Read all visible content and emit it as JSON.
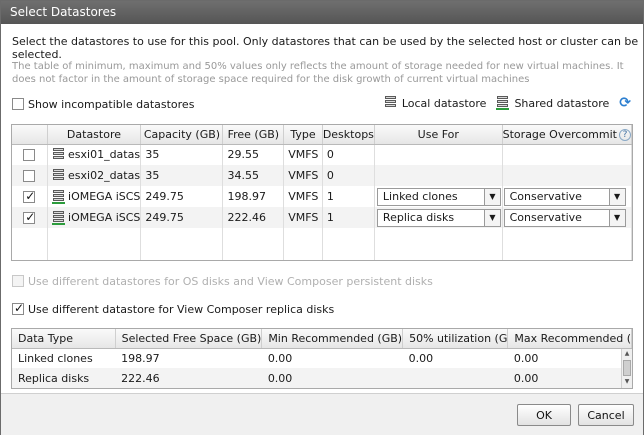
{
  "window": {
    "title": "Select Datastores"
  },
  "intro": "Select the datastores to use for this pool. Only datastores that can be used by the selected host or cluster can be selected.",
  "note": "The table of minimum, maximum and 50% values only reflects the amount of storage needed for new virtual machines. It does not factor in the amount of storage space required for the disk growth of current virtual machines",
  "show_incompatible": {
    "label": "Show incompatible datastores",
    "checked": false
  },
  "legend": {
    "local": "Local datastore",
    "shared": "Shared datastore"
  },
  "datastore_table": {
    "headers": [
      "",
      "Datastore",
      "Capacity (GB)",
      "Free (GB)",
      "Type",
      "Desktops",
      "Use For",
      "Storage Overcommit"
    ],
    "help_icon": "?",
    "rows": [
      {
        "checked": false,
        "icon": "local",
        "name": "esxi01_datas",
        "capacity": "35",
        "free": "29.55",
        "type": "VMFS",
        "desktops": "0",
        "use_for": "",
        "overcommit": ""
      },
      {
        "checked": false,
        "icon": "local",
        "name": "esxi02_datas",
        "capacity": "35",
        "free": "34.55",
        "type": "VMFS",
        "desktops": "0",
        "use_for": "",
        "overcommit": ""
      },
      {
        "checked": true,
        "icon": "shared",
        "name": "iOMEGA iSCS",
        "capacity": "249.75",
        "free": "198.97",
        "type": "VMFS",
        "desktops": "1",
        "use_for": "Linked clones",
        "overcommit": "Conservative"
      },
      {
        "checked": true,
        "icon": "shared",
        "name": "iOMEGA iSCS",
        "capacity": "249.75",
        "free": "222.46",
        "type": "VMFS",
        "desktops": "1",
        "use_for": "Replica disks",
        "overcommit": "Conservative"
      }
    ]
  },
  "options": {
    "os_disks": {
      "label": "Use different datastores for OS disks and View Composer persistent disks",
      "checked": false,
      "enabled": false
    },
    "replica": {
      "label": "Use different datastore for View Composer replica disks",
      "checked": true,
      "enabled": true
    }
  },
  "summary_table": {
    "headers": [
      "Data Type",
      "Selected Free Space (GB)",
      "Min Recommended (GB)",
      "50% utilization (G",
      "Max Recommended ("
    ],
    "rows": [
      [
        "Linked clones",
        "198.97",
        "0.00",
        "0.00",
        "0.00"
      ],
      [
        "Replica disks",
        "222.46",
        "0.00",
        "",
        "0.00"
      ]
    ]
  },
  "buttons": {
    "ok": "OK",
    "cancel": "Cancel"
  }
}
